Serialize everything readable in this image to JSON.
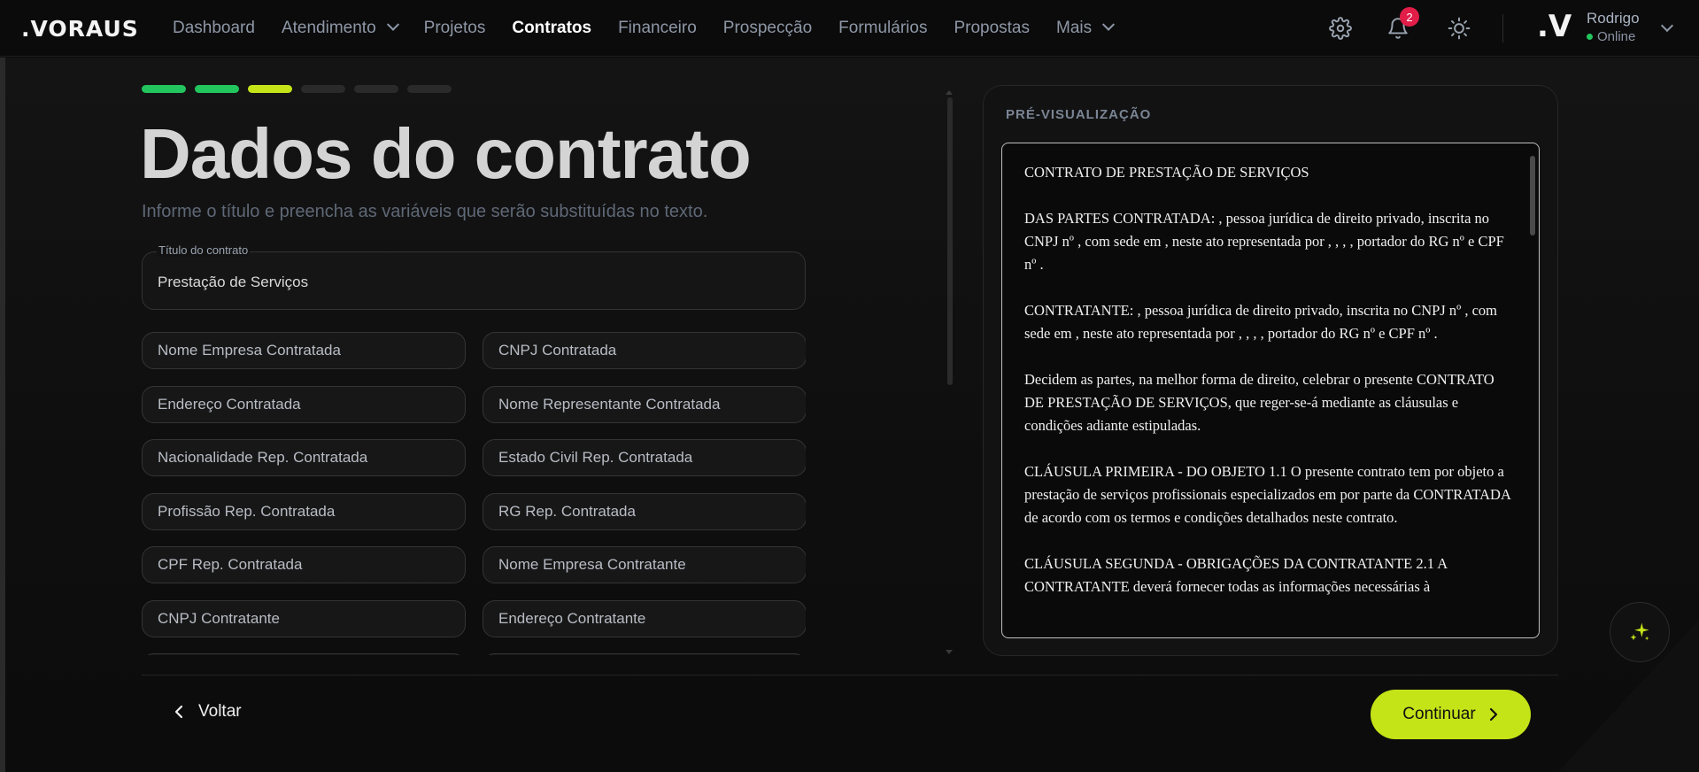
{
  "brand": {
    "logo": ".VORAUS"
  },
  "nav": {
    "items": [
      {
        "label": "Dashboard",
        "has_menu": false,
        "active": false
      },
      {
        "label": "Atendimento",
        "has_menu": true,
        "active": false
      },
      {
        "label": "Projetos",
        "has_menu": false,
        "active": false
      },
      {
        "label": "Contratos",
        "has_menu": false,
        "active": true
      },
      {
        "label": "Financeiro",
        "has_menu": false,
        "active": false
      },
      {
        "label": "Prospecção",
        "has_menu": false,
        "active": false
      },
      {
        "label": "Formulários",
        "has_menu": false,
        "active": false
      },
      {
        "label": "Propostas",
        "has_menu": false,
        "active": false
      },
      {
        "label": "Mais",
        "has_menu": true,
        "active": false
      }
    ]
  },
  "header_actions": {
    "settings_icon": "gear-icon",
    "notifications_icon": "bell-icon",
    "notifications_count": "2",
    "theme_icon": "sun-icon"
  },
  "user": {
    "avatar": ".V",
    "name": "Rodrigo",
    "status": "Online"
  },
  "wizard": {
    "steps_total": 6,
    "steps_done": 2,
    "current_step": 3,
    "title": "Dados do contrato",
    "subtitle": "Informe o título e preencha as variáveis que serão substituídas no texto.",
    "contract_title_label": "Título do contrato",
    "contract_title_value": "Prestação de Serviços",
    "variables": [
      "Nome Empresa Contratada",
      "CNPJ Contratada",
      "Endereço Contratada",
      "Nome Representante Contratada",
      "Nacionalidade Rep. Contratada",
      "Estado Civil Rep. Contratada",
      "Profissão Rep. Contratada",
      "RG Rep. Contratada",
      "CPF Rep. Contratada",
      "Nome Empresa Contratante",
      "CNPJ Contratante",
      "Endereço Contratante"
    ]
  },
  "preview": {
    "heading": "PRÉ-VISUALIZAÇÃO",
    "paragraphs": [
      "CONTRATO DE PRESTAÇÃO DE SERVIÇOS",
      "DAS PARTES CONTRATADA: , pessoa jurídica de direito privado, inscrita no CNPJ nº , com sede em , neste ato representada por , , , , portador do RG nº  e CPF nº .",
      "CONTRATANTE: , pessoa jurídica de direito privado, inscrita no CNPJ nº , com sede em , neste ato representada por , , , , portador do RG nº  e CPF nº .",
      "Decidem as partes, na melhor forma de direito, celebrar o presente CONTRATO DE PRESTAÇÃO DE SERVIÇOS, que reger-se-á mediante as cláusulas e condições adiante estipuladas.",
      "CLÁUSULA PRIMEIRA - DO OBJETO 1.1 O presente contrato tem por objeto a prestação de serviços profissionais especializados em  por parte da CONTRATADA de acordo com os termos e condições detalhados neste contrato.",
      "CLÁUSULA SEGUNDA - OBRIGAÇÕES DA CONTRATANTE 2.1 A CONTRATANTE deverá fornecer todas as informações necessárias à"
    ]
  },
  "footer": {
    "back_label": "Voltar",
    "continue_label": "Continuar"
  },
  "colors": {
    "accent": "#c5e418",
    "step_done": "#22c55e",
    "badge": "#e11d48"
  }
}
